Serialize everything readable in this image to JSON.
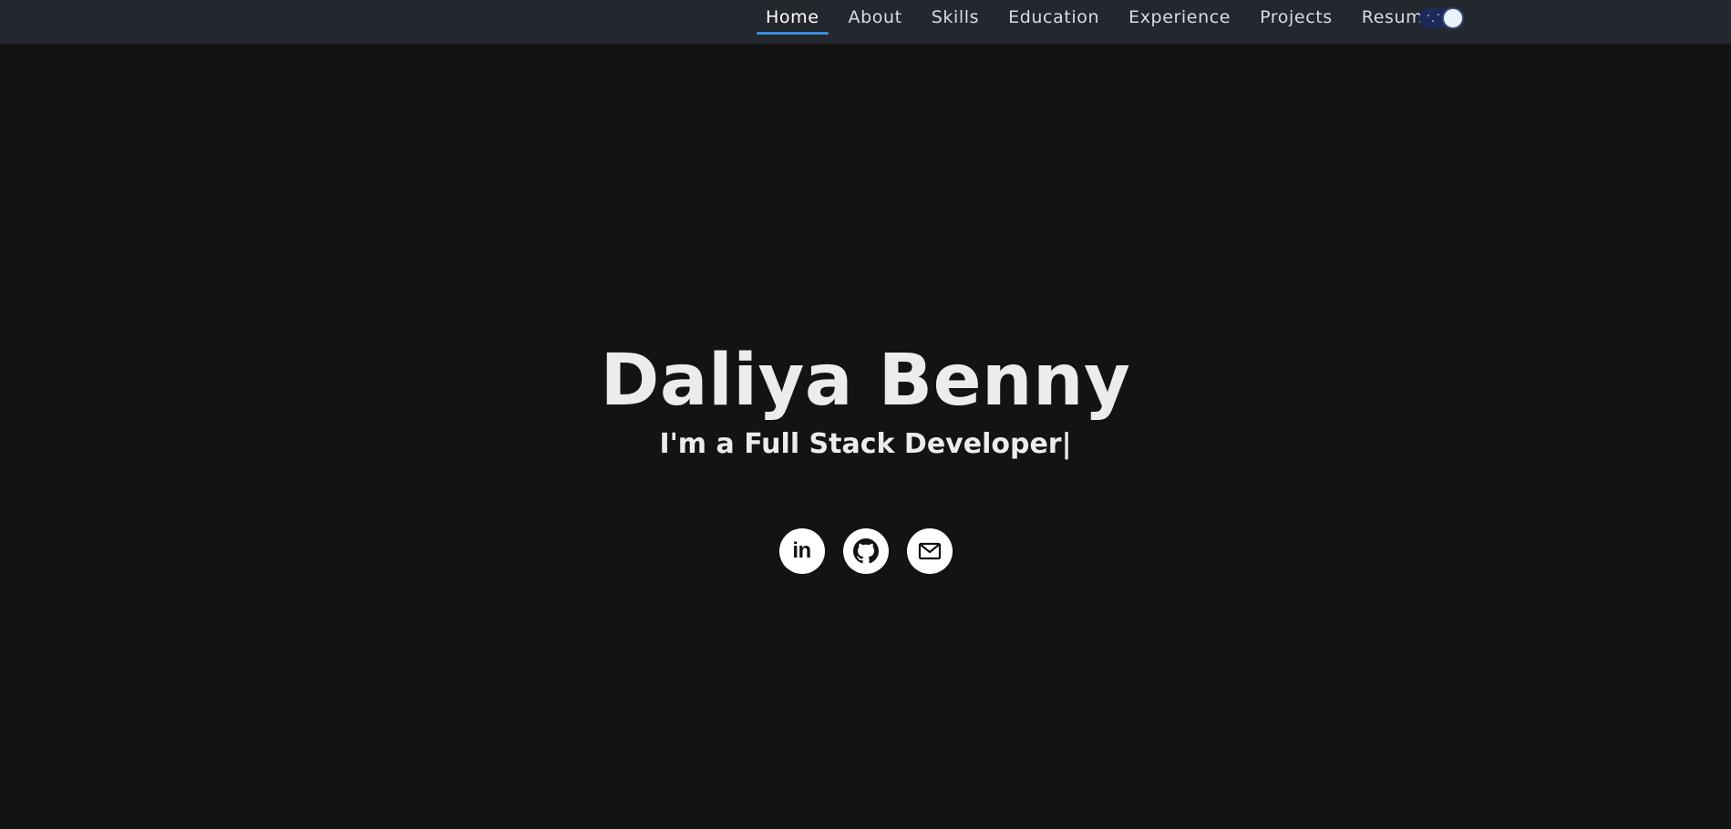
{
  "nav": {
    "items": [
      {
        "label": "Home",
        "active": true
      },
      {
        "label": "About"
      },
      {
        "label": "Skills"
      },
      {
        "label": "Education"
      },
      {
        "label": "Experience"
      },
      {
        "label": "Projects"
      },
      {
        "label": "Resume"
      }
    ],
    "theme_toggle": {
      "state": "dark",
      "icon": "moon-toggle-icon"
    }
  },
  "hero": {
    "name": "Daliya Benny",
    "tagline_prefix": "I'm a ",
    "tagline_role": "Full Stack Developer|"
  },
  "socials": {
    "linkedin_text": "in",
    "icons": [
      "linkedin-icon",
      "github-icon",
      "mail-icon"
    ]
  },
  "colors": {
    "background": "#131313",
    "navbar": "#23272e",
    "accent": "#3a8fe0",
    "text": "#ececec"
  }
}
